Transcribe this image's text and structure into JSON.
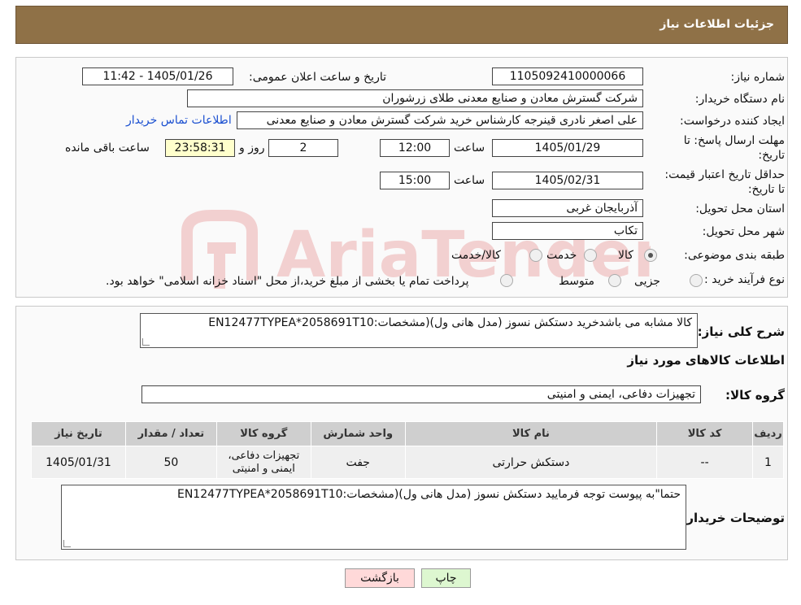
{
  "header": {
    "title": "جزئیات اطلاعات نیاز"
  },
  "form": {
    "need_number_label": "شماره نیاز:",
    "need_number": "1105092410000066",
    "announce_label": "تاریخ و ساعت اعلان عمومی:",
    "announce_value": "1405/01/26 - 11:42",
    "buyer_org_label": "نام دستگاه خریدار:",
    "buyer_org": "شرکت گسترش معادن و صنایع معدنی طلای زرشوران",
    "creator_label": "ایجاد کننده درخواست:",
    "creator": "علی اصغر نادری قینرجه کارشناس خرید  شرکت گسترش معادن و صنایع معدنی",
    "contact_link": "اطلاعات تماس خریدار",
    "deadline_label": "مهلت ارسال پاسخ: تا تاریخ:",
    "deadline_date": "1405/01/29",
    "time_label": "ساعت",
    "deadline_time": "12:00",
    "days_value": "2",
    "days_label": "روز و",
    "remaining_time": "23:58:31",
    "remaining_label": "ساعت باقی مانده",
    "validity_label": "حداقل تاریخ اعتبار قیمت: تا تاریخ:",
    "validity_date": "1405/02/31",
    "validity_time": "15:00",
    "province_label": "استان محل تحویل:",
    "province": "آذربایجان غربی",
    "city_label": "شهر محل تحویل:",
    "city": "تکاب",
    "category_label": "طبقه بندی موضوعی:",
    "category_options": [
      "کالا",
      "خدمت",
      "کالا/خدمت"
    ],
    "purchase_type_label": "نوع فرآیند خرید :",
    "purchase_options": [
      "جزیی",
      "متوسط"
    ],
    "purchase_note": "پرداخت تمام یا بخشی از مبلغ خرید،از محل \"اسناد خزانه اسلامی\" خواهد بود."
  },
  "description": {
    "label": "شرح کلی نیاز:",
    "text": "کالا مشابه می باشدخرید دستکش نسوز (مدل هانی ول)(مشخصات:EN12477TYPEA*2058691T10"
  },
  "goods": {
    "section_title": "اطلاعات کالاهای مورد نیاز",
    "group_label": "گروه کالا:",
    "group_value": "تجهیزات دفاعی، ایمنی و امنیتی",
    "columns": [
      "ردیف",
      "کد کالا",
      "نام کالا",
      "واحد شمارش",
      "گروه کالا",
      "تعداد / مقدار",
      "تاریخ نیاز"
    ],
    "rows": [
      [
        "1",
        "--",
        "دستکش حرارتی",
        "جفت",
        "تجهیزات دفاعی، ایمنی و امنیتی",
        "50",
        "1405/01/31"
      ]
    ]
  },
  "buyer_notes": {
    "label": "توضیحات خریدار:",
    "text": "حتما\"به پیوست توجه فرمایید دستکش نسوز (مدل هانی ول)(مشخصات:EN12477TYPEA*2058691T10"
  },
  "buttons": {
    "print": "چاپ",
    "back": "بازگشت"
  },
  "watermark_text": "AriaTender.neT",
  "colors": {
    "header_bg": "#8f7147",
    "link": "#1a4fd0",
    "back_button_bg": "#ffd9d9",
    "print_button_bg": "#ddf7d0",
    "remaining_bg": "#ffffcc"
  }
}
